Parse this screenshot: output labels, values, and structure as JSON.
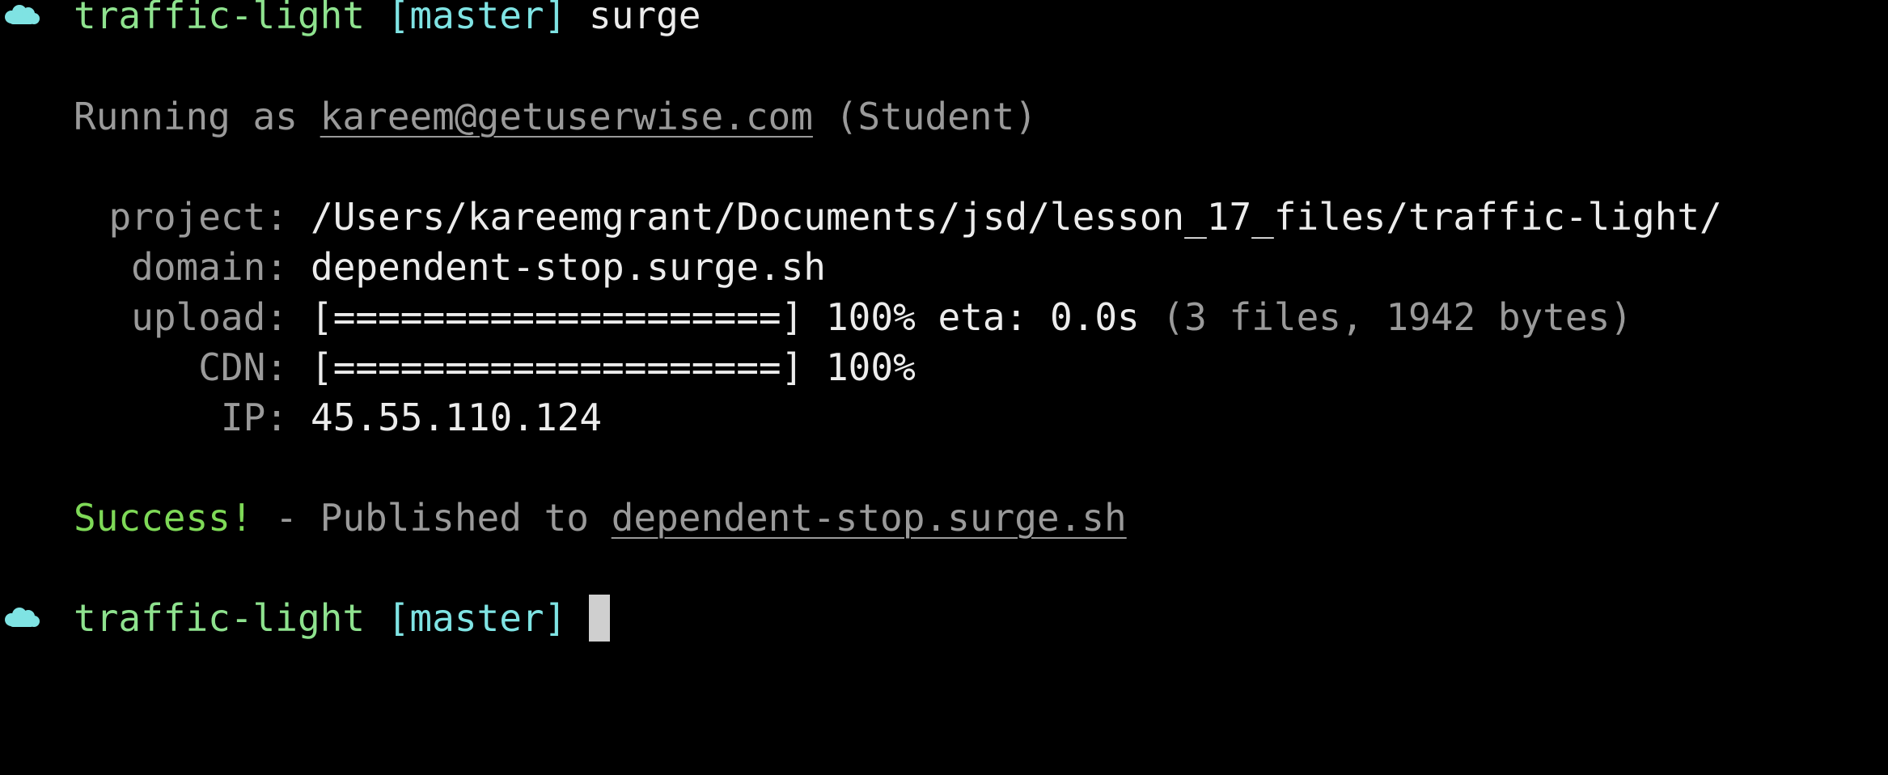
{
  "colors": {
    "background": "#000000",
    "prompt_dir": "#8ee28e",
    "prompt_branch": "#7fe3e3",
    "command": "#ececec",
    "dim": "#9a9a9a",
    "success": "#7ed957",
    "cursor": "#cfcfcf"
  },
  "prompt1": {
    "icon": "cloud-icon",
    "dir": "traffic-light",
    "branch": "[master]",
    "command": "surge"
  },
  "running": {
    "prefix": "Running as",
    "email": "kareem@getuserwise.com",
    "role": "(Student)"
  },
  "details": {
    "project_key": "project:",
    "project_val": "/Users/kareemgrant/Documents/jsd/lesson_17_files/traffic-light/",
    "domain_key": "domain:",
    "domain_val": "dependent-stop.surge.sh",
    "upload_key": "upload:",
    "upload_bar": "[====================]",
    "upload_pct": "100%",
    "upload_eta": "eta: 0.0s",
    "upload_info": "(3 files, 1942 bytes)",
    "cdn_key": "CDN:",
    "cdn_bar": "[====================]",
    "cdn_pct": "100%",
    "ip_key": "IP:",
    "ip_val": "45.55.110.124"
  },
  "result": {
    "success": "Success!",
    "middle": "- Published to",
    "link": "dependent-stop.surge.sh"
  },
  "prompt2": {
    "icon": "cloud-icon",
    "dir": "traffic-light",
    "branch": "[master]"
  }
}
